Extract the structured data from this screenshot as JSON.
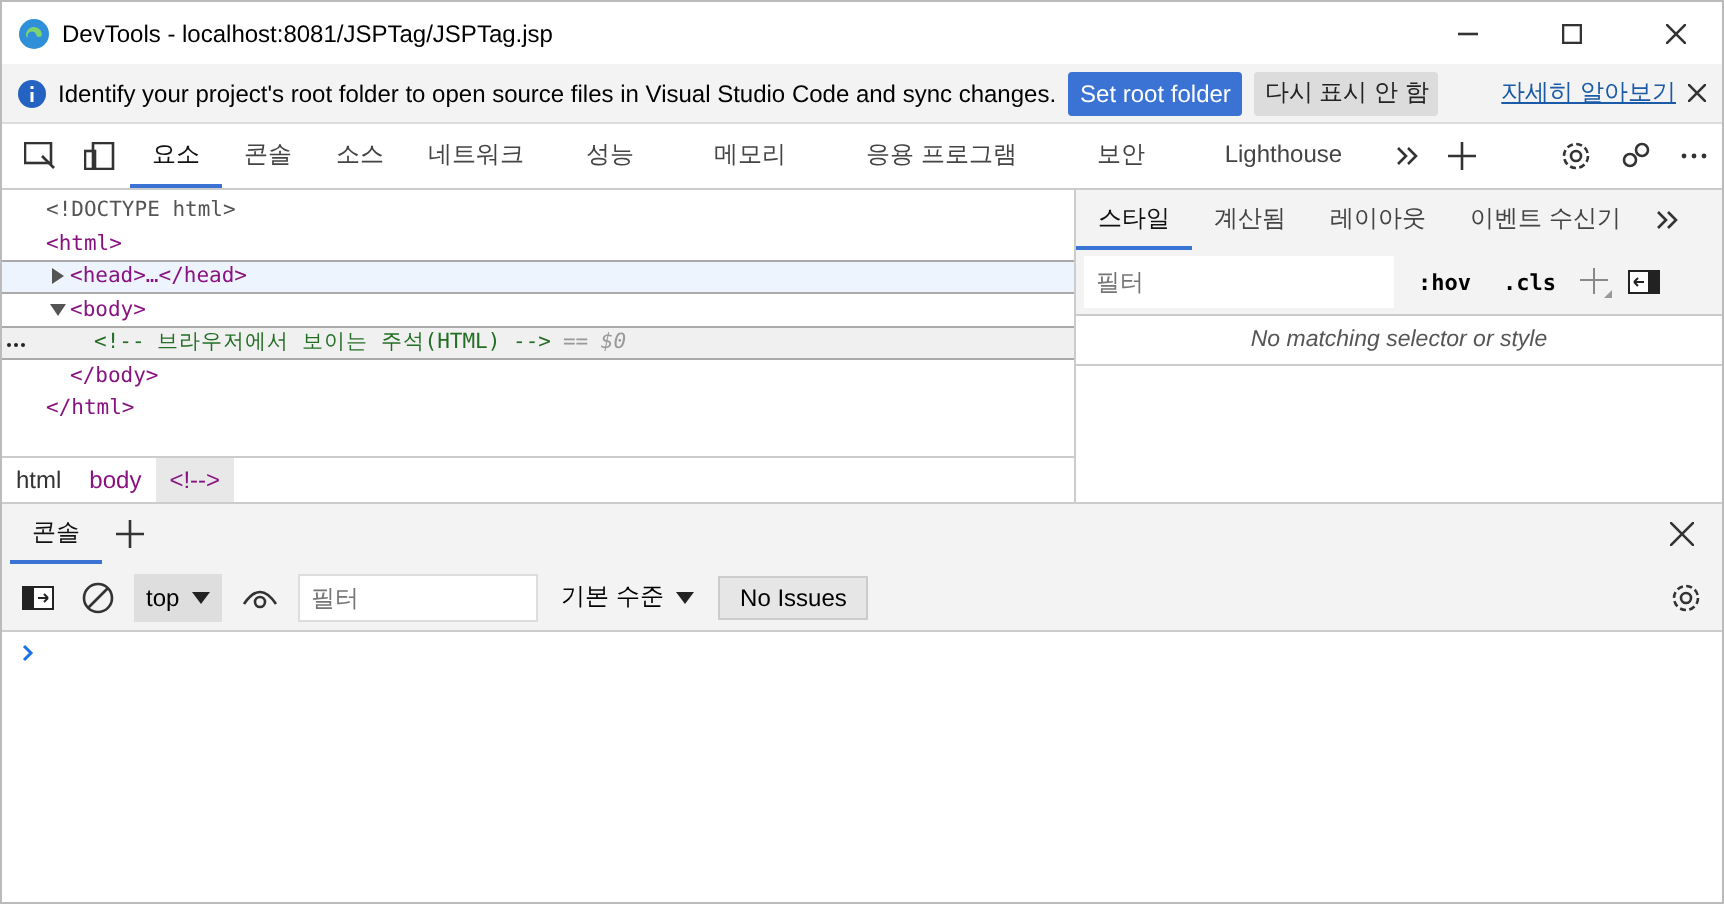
{
  "window": {
    "title": "DevTools - localhost:8081/JSPTag/JSPTag.jsp"
  },
  "infobar": {
    "message": "Identify your project's root folder to open source files in Visual Studio Code and sync changes.",
    "primary_button": "Set root folder",
    "secondary_button": "다시 표시 안 함",
    "link": "자세히 알아보기"
  },
  "tabs": [
    {
      "label": "요소",
      "selected": true
    },
    {
      "label": "콘솔",
      "selected": false
    },
    {
      "label": "소스",
      "selected": false
    },
    {
      "label": "네트워크",
      "selected": false
    },
    {
      "label": "성능",
      "selected": false
    },
    {
      "label": "메모리",
      "selected": false
    },
    {
      "label": "응용 프로그램",
      "selected": false
    },
    {
      "label": "보안",
      "selected": false
    },
    {
      "label": "Lighthouse",
      "selected": false
    }
  ],
  "dom_tree": [
    {
      "kind": "doctype",
      "text": "<!DOCTYPE html>",
      "selected": false,
      "hovered": false
    },
    {
      "kind": "element",
      "text": "<html>",
      "close": "</html>",
      "selected": false,
      "hovered": false,
      "children": [
        {
          "kind": "element",
          "text": "<head>…</head>",
          "expanded": false,
          "selected": false,
          "hovered": true
        },
        {
          "kind": "element",
          "text": "<body>",
          "close": "</body>",
          "expanded": true,
          "selected": false,
          "hovered": false,
          "children": [
            {
              "kind": "comment",
              "text": "<!-- 브라우저에서 보이는 주석(HTML) -->",
              "suffix": "== $0",
              "selected": true,
              "hovered": false
            }
          ]
        }
      ]
    }
  ],
  "breadcrumbs": [
    {
      "label": "html",
      "selected": false
    },
    {
      "label": "body",
      "selected": false
    },
    {
      "label": "<!-->",
      "selected": true
    }
  ],
  "styles_tabs": [
    {
      "label": "스타일",
      "selected": true
    },
    {
      "label": "계산됨",
      "selected": false
    },
    {
      "label": "레이아웃",
      "selected": false
    },
    {
      "label": "이벤트 수신기",
      "selected": false
    }
  ],
  "styles": {
    "filter_placeholder": "필터",
    "hov": ":hov",
    "cls": ".cls",
    "empty_message": "No matching selector or style"
  },
  "drawer": {
    "tabs": [
      {
        "label": "콘솔",
        "selected": true
      }
    ],
    "context": "top",
    "filter_placeholder": "필터",
    "level": "기본 수준",
    "issues": "No Issues"
  }
}
